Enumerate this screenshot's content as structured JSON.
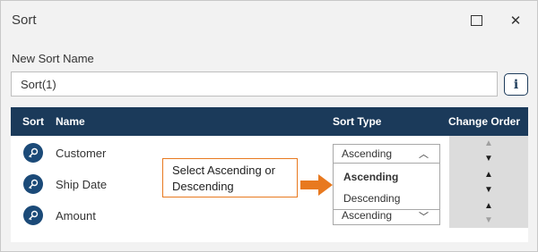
{
  "dialog": {
    "title": "Sort",
    "maximize_icon": "maximize-icon",
    "close_icon": "close-icon",
    "close_glyph": "✕"
  },
  "sort_name": {
    "label": "New Sort Name",
    "value": "Sort(1)",
    "info_glyph": "i"
  },
  "table": {
    "headers": {
      "sort": "Sort",
      "name": "Name",
      "sort_type": "Sort Type",
      "change_order": "Change Order"
    },
    "rows": [
      {
        "name": "Customer",
        "sort_type": "Ascending",
        "icon": "sort-key-icon"
      },
      {
        "name": "Ship Date",
        "sort_type": "Ascending",
        "icon": "sort-key-icon"
      },
      {
        "name": "Amount",
        "sort_type": "Ascending",
        "icon": "sort-key-icon"
      }
    ],
    "order_glyphs": {
      "up": "▲",
      "down": "▼"
    }
  },
  "dropdown": {
    "options": [
      "Ascending",
      "Descending"
    ],
    "selected": "Ascending",
    "chevron_up": "︿",
    "chevron_down": "﹀"
  },
  "callout": {
    "text_line1": "Select Ascending or",
    "text_line2": "Descending"
  },
  "colors": {
    "header_bg": "#1b3a5a",
    "callout_accent": "#e8791f",
    "icon_bg": "#1b4a78"
  }
}
